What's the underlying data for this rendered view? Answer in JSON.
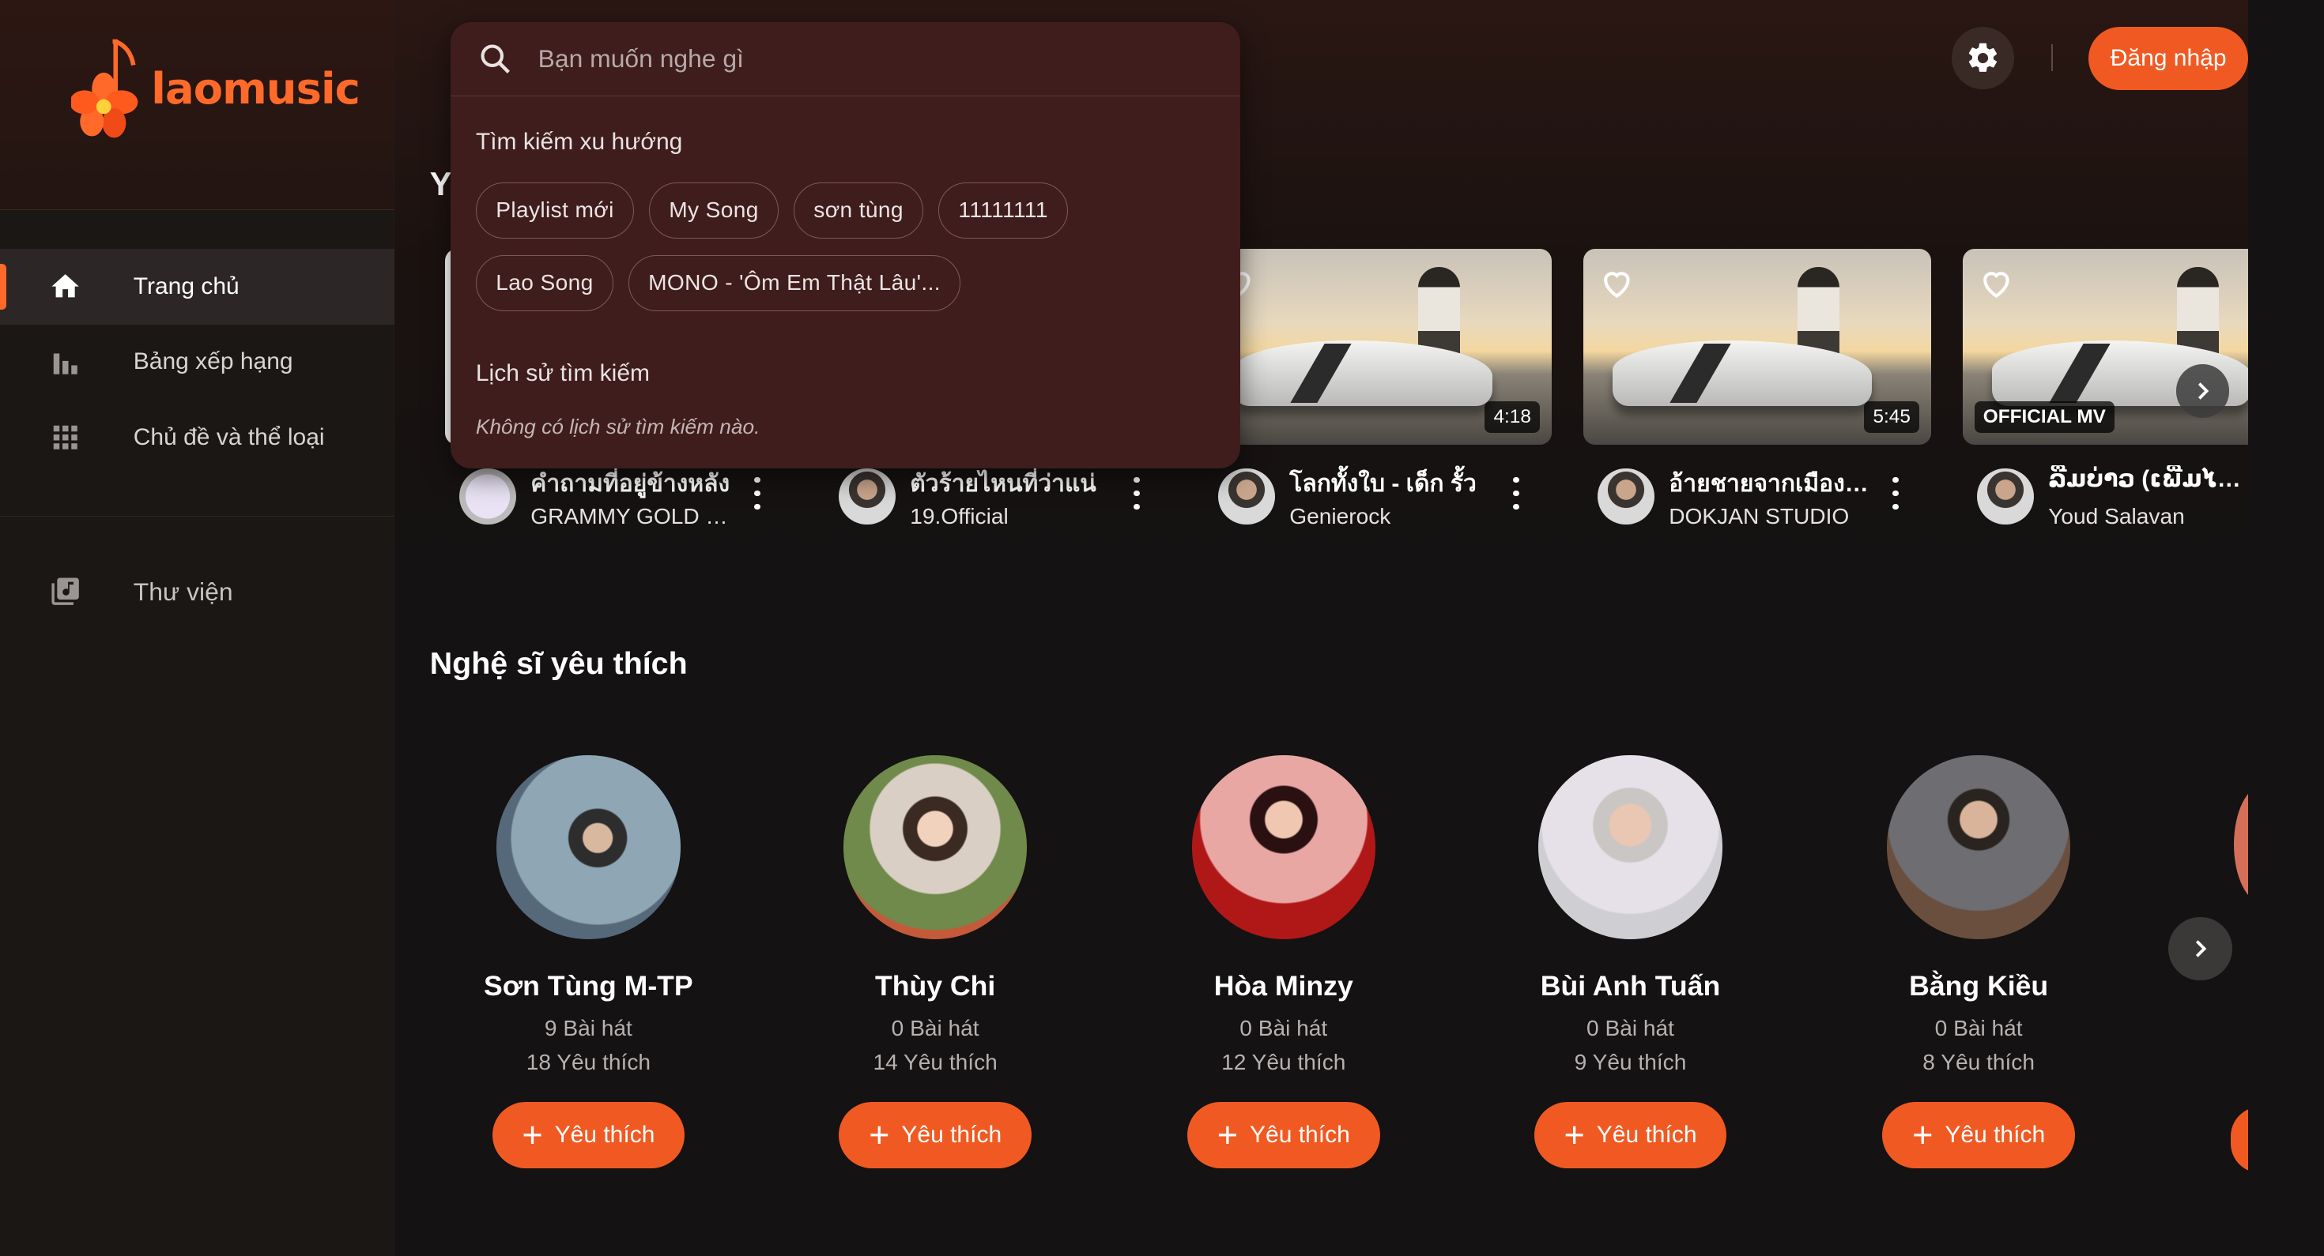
{
  "app": {
    "logo_text": "laomusic",
    "brand_color": "#f05a22"
  },
  "sidebar": {
    "items": [
      {
        "label": "Trang chủ",
        "icon": "home-icon",
        "active": true
      },
      {
        "label": "Bảng xếp hạng",
        "icon": "bar-chart-icon",
        "active": false
      },
      {
        "label": "Chủ đề và thể loại",
        "icon": "grid-icon",
        "active": false
      }
    ],
    "library": {
      "label": "Thư viện",
      "icon": "library-music-icon"
    }
  },
  "header": {
    "login_label": "Đăng nhập",
    "settings_icon": "gear-icon"
  },
  "search": {
    "placeholder": "Bạn muốn nghe gì",
    "trending_title": "Tìm kiếm xu hướng",
    "trending": [
      "Playlist mới",
      "My Song",
      "sơn tùng",
      "11111111",
      "Lao Song",
      "MONO - 'Ôm Em Thật Lâu'..."
    ],
    "history_title": "Lịch sử tìm kiếm",
    "history_empty": "Không có lịch sử tìm kiếm nào."
  },
  "videos": {
    "section_title_partial": "Y",
    "items": [
      {
        "title": "คำถามที่อยู่ข้างหลัง",
        "channel": "GRAMMY GOLD OFFICIAL",
        "duration": ""
      },
      {
        "title": "ตัวร้ายไหนที่ว่าแน่",
        "channel": "19.Official",
        "duration": ""
      },
      {
        "title": "โลกทั้งใบ - เด็ก รั้ว",
        "channel": "Genierock",
        "duration": "4:18"
      },
      {
        "title": "อ้ายชายจากเมืองลาว",
        "channel": "DOKJAN STUDIO",
        "duration": "5:45"
      },
      {
        "title": "ລືມບ່າວ (ເພີ່ມໄຟຄວາມຮັກ)",
        "channel": "Youd Salavan",
        "duration": "OFFICIAL MV"
      }
    ]
  },
  "artists": {
    "section_title": "Nghệ sĩ yêu thích",
    "follow_label": "Yêu thích",
    "items": [
      {
        "name": "Sơn Tùng M-TP",
        "songs": "9 Bài hát",
        "likes": "18 Yêu thích"
      },
      {
        "name": "Thùy Chi",
        "songs": "0 Bài hát",
        "likes": "14 Yêu thích"
      },
      {
        "name": "Hòa Minzy",
        "songs": "0 Bài hát",
        "likes": "12 Yêu thích"
      },
      {
        "name": "Bùi Anh Tuấn",
        "songs": "0 Bài hát",
        "likes": "9 Yêu thích"
      },
      {
        "name": "Bằng Kiều",
        "songs": "0 Bài hát",
        "likes": "8 Yêu thích"
      }
    ]
  }
}
